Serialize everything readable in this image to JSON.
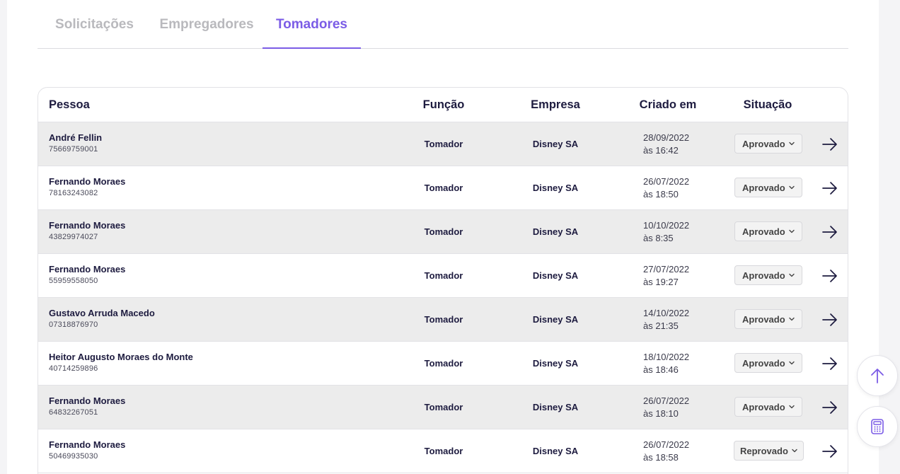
{
  "tabs": [
    {
      "label": "Solicitações",
      "active": false
    },
    {
      "label": "Empregadores",
      "active": false
    },
    {
      "label": "Tomadores",
      "active": true
    }
  ],
  "table": {
    "headers": {
      "pessoa": "Pessoa",
      "funcao": "Função",
      "empresa": "Empresa",
      "criado": "Criado em",
      "situacao": "Situação"
    },
    "rows": [
      {
        "name": "André Fellin",
        "id": "75669759001",
        "funcao": "Tomador",
        "empresa": "Disney SA",
        "date": "28/09/2022",
        "time": "às 16:42",
        "status": "Aprovado"
      },
      {
        "name": "Fernando Moraes",
        "id": "78163243082",
        "funcao": "Tomador",
        "empresa": "Disney SA",
        "date": "26/07/2022",
        "time": "às 18:50",
        "status": "Aprovado"
      },
      {
        "name": "Fernando Moraes",
        "id": "43829974027",
        "funcao": "Tomador",
        "empresa": "Disney SA",
        "date": "10/10/2022",
        "time": "às 8:35",
        "status": "Aprovado"
      },
      {
        "name": "Fernando Moraes",
        "id": "55959558050",
        "funcao": "Tomador",
        "empresa": "Disney SA",
        "date": "27/07/2022",
        "time": "às 19:27",
        "status": "Aprovado"
      },
      {
        "name": "Gustavo Arruda Macedo",
        "id": "07318876970",
        "funcao": "Tomador",
        "empresa": "Disney SA",
        "date": "14/10/2022",
        "time": "às 21:35",
        "status": "Aprovado"
      },
      {
        "name": "Heitor Augusto Moraes do Monte",
        "id": "40714259896",
        "funcao": "Tomador",
        "empresa": "Disney SA",
        "date": "18/10/2022",
        "time": "às 18:46",
        "status": "Aprovado"
      },
      {
        "name": "Fernando Moraes",
        "id": "64832267051",
        "funcao": "Tomador",
        "empresa": "Disney SA",
        "date": "26/07/2022",
        "time": "às 18:10",
        "status": "Aprovado"
      },
      {
        "name": "Fernando Moraes",
        "id": "50469935030",
        "funcao": "Tomador",
        "empresa": "Disney SA",
        "date": "26/07/2022",
        "time": "às 18:58",
        "status": "Reprovado"
      }
    ]
  },
  "icons": {
    "row_action": "arrow-right-icon",
    "status_dropdown": "chevron-down-icon",
    "scroll_top": "arrow-up-icon",
    "calculator": "calculator-icon"
  },
  "colors": {
    "accent": "#7b5ce6",
    "text_dark": "#1d1b3f",
    "tab_inactive": "#b9b9bd",
    "row_shaded": "#ececec"
  }
}
